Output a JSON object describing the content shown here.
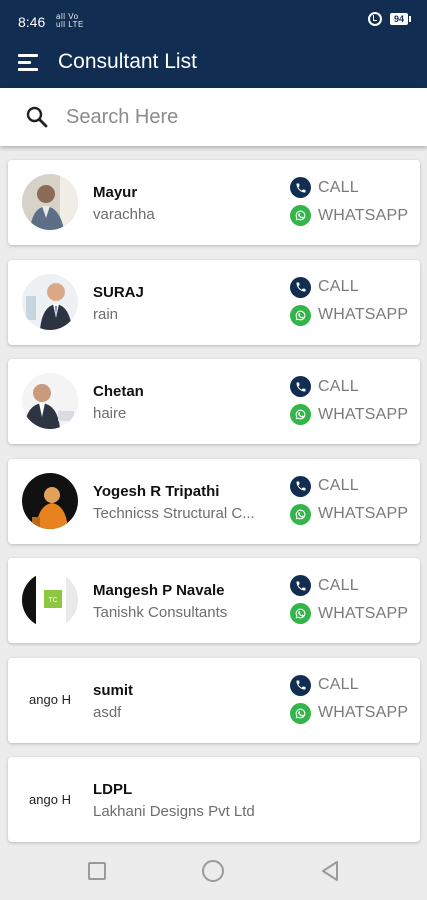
{
  "status_bar": {
    "time": "8:46",
    "network_top": "all Vo",
    "network_bottom": "ull LTE",
    "battery": "94"
  },
  "app_bar": {
    "title": "Consultant List"
  },
  "search": {
    "placeholder": "Search Here",
    "value": ""
  },
  "actions": {
    "call_label": "CALL",
    "whatsapp_label": "WHATSAPP"
  },
  "consultants": [
    {
      "name": "Mayur",
      "subtitle": "varachha",
      "avatar": "photo"
    },
    {
      "name": "SURAJ",
      "subtitle": "rain",
      "avatar": "photo"
    },
    {
      "name": "Chetan",
      "subtitle": "haire",
      "avatar": "photo"
    },
    {
      "name": "Yogesh R Tripathi",
      "subtitle": "Technicss Structural C...",
      "avatar": "photo"
    },
    {
      "name": "Mangesh P Navale",
      "subtitle": "Tanishk Consultants",
      "avatar": "photo"
    },
    {
      "name": "sumit",
      "subtitle": "asdf",
      "avatar": "logo",
      "avatar_text": "ango H"
    },
    {
      "name": "LDPL",
      "subtitle": "Lakhani Designs Pvt Ltd",
      "avatar": "logo",
      "avatar_text": "ango H"
    }
  ],
  "colors": {
    "primary": "#112d52",
    "whatsapp": "#33b54a",
    "background": "#ececec"
  }
}
